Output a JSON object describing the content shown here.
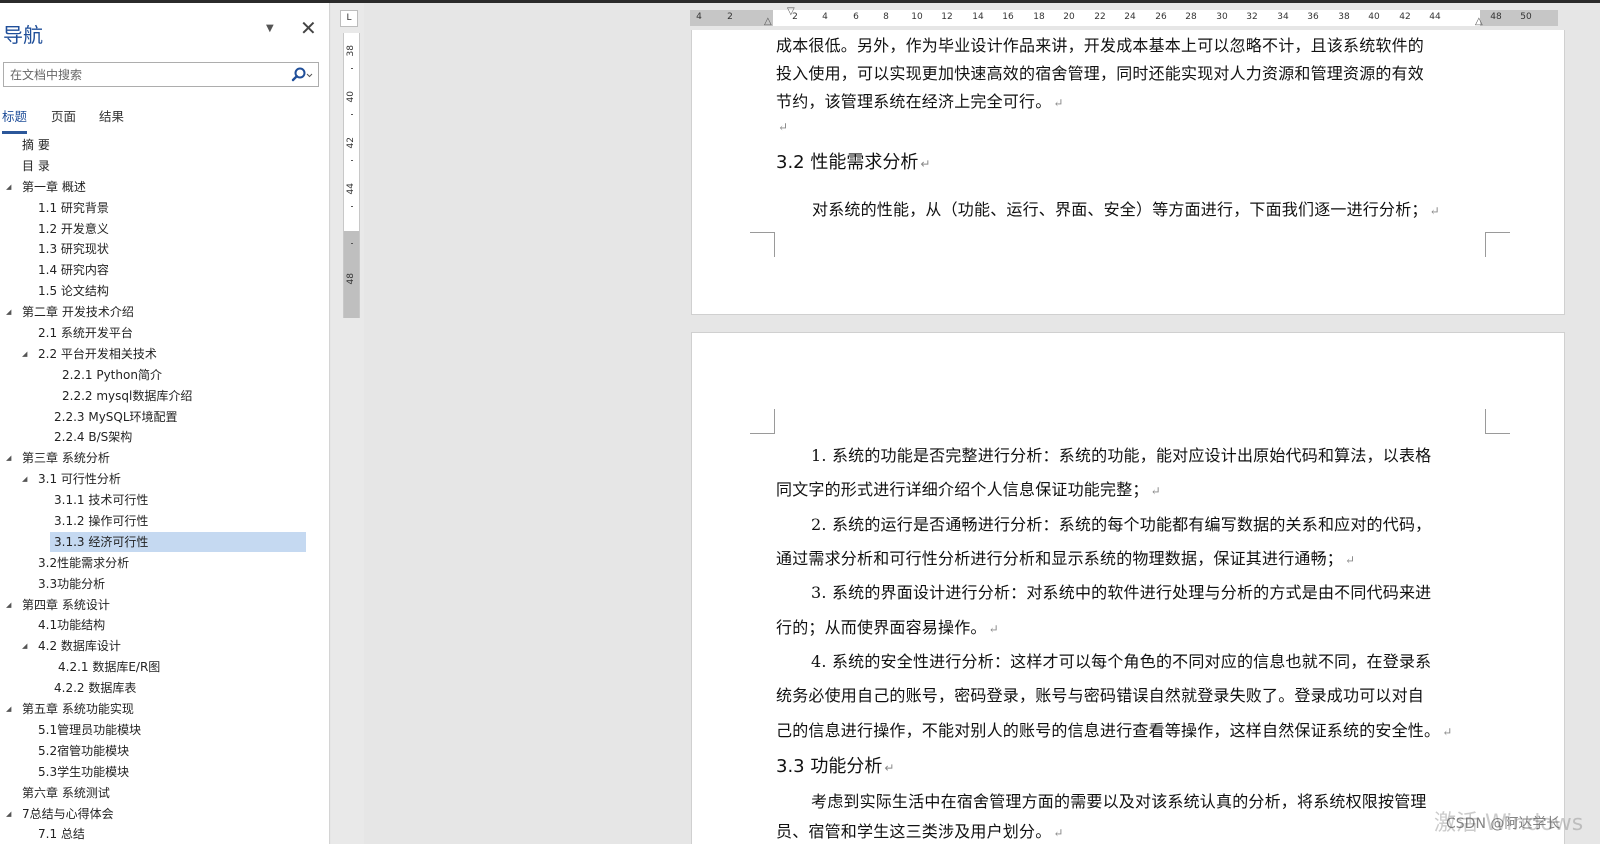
{
  "nav": {
    "title": "导航",
    "dropdown_icon": "triangle-down-icon",
    "close_glyph": "✕",
    "search": {
      "placeholder": "在文档中搜索"
    },
    "tabs": [
      {
        "label": "标题",
        "active": true
      },
      {
        "label": "页面",
        "active": false
      },
      {
        "label": "结果",
        "active": false
      }
    ],
    "headings": [
      {
        "label": "摘  要",
        "level": 0,
        "expand": false
      },
      {
        "label": "目  录",
        "level": 0,
        "expand": false
      },
      {
        "label": "第一章  概述",
        "level": 0,
        "expand": true
      },
      {
        "label": "1.1 研究背景",
        "level": 1,
        "expand": false
      },
      {
        "label": "1.2 开发意义",
        "level": 1,
        "expand": false
      },
      {
        "label": "1.3 研究现状",
        "level": 1,
        "expand": false
      },
      {
        "label": "1.4 研究内容",
        "level": 1,
        "expand": false
      },
      {
        "label": "1.5 论文结构",
        "level": 1,
        "expand": false
      },
      {
        "label": " 第二章  开发技术介绍",
        "level": 0,
        "expand": true
      },
      {
        "label": "2.1 系统开发平台",
        "level": 1,
        "expand": false
      },
      {
        "label": "2.2 平台开发相关技术",
        "level": 1,
        "expand": true
      },
      {
        "label": "2.2.1   Python简介",
        "level": 3,
        "expand": false
      },
      {
        "label": "2.2.2   mysql数据库介绍",
        "level": 3,
        "expand": false
      },
      {
        "label": "2.2.3   MySQL环境配置",
        "level": 2,
        "expand": false
      },
      {
        "label": "2.2.4   B/S架构",
        "level": 2,
        "expand": false
      },
      {
        "label": "第三章  系统分析",
        "level": 0,
        "expand": true
      },
      {
        "label": "3.1 可行性分析",
        "level": 1,
        "expand": true
      },
      {
        "label": "3.1.1 技术可行性",
        "level": 2,
        "expand": false
      },
      {
        "label": "3.1.2 操作可行性",
        "level": 2,
        "expand": false
      },
      {
        "label": "3.1.3 经济可行性",
        "level": 2,
        "expand": false,
        "selected": true
      },
      {
        "label": "3.2性能需求分析",
        "level": 1,
        "expand": false
      },
      {
        "label": "3.3功能分析",
        "level": 1,
        "expand": false
      },
      {
        "label": "第四章  系统设计",
        "level": 0,
        "expand": true
      },
      {
        "label": "4.1功能结构",
        "level": 1,
        "expand": false
      },
      {
        "label": "4.2 数据库设计",
        "level": 1,
        "expand": true
      },
      {
        "label": "4.2.1 数据库E/R图",
        "level": 2.3,
        "expand": false
      },
      {
        "label": "4.2.2 数据库表",
        "level": 2,
        "expand": false
      },
      {
        "label": "第五章  系统功能实现",
        "level": 0,
        "expand": true
      },
      {
        "label": "5.1管理员功能模块",
        "level": 1,
        "expand": false
      },
      {
        "label": "5.2宿管功能模块",
        "level": 1,
        "expand": false
      },
      {
        "label": "5.3学生功能模块",
        "level": 1,
        "expand": false
      },
      {
        "label": "第六章  系统测试",
        "level": 0,
        "expand": false
      },
      {
        "label": "7总结与心得体会",
        "level": 0,
        "expand": true
      },
      {
        "label": "7.1 总结",
        "level": 1,
        "expand": false
      }
    ]
  },
  "rulers": {
    "tab_selector": "L",
    "horizontal": [
      "4",
      "2",
      "2",
      "4",
      "6",
      "8",
      "10",
      "12",
      "14",
      "16",
      "18",
      "20",
      "22",
      "24",
      "26",
      "28",
      "30",
      "32",
      "34",
      "36",
      "38",
      "40",
      "42",
      "44",
      "48",
      "50"
    ],
    "vertical": [
      "38",
      "40",
      "42",
      "44",
      "48"
    ]
  },
  "document": {
    "page1": {
      "lines": [
        "成本很低。另外，作为毕业设计作品来讲，开发成本基本上可以忽略不计，且该系统软件的",
        "投入使用，可以实现更加快速高效的宿舍管理，同时还能实现对人力资源和管理资源的有效",
        "节约，该管理系统在经济上完全可行。",
        ""
      ],
      "heading": "3.2 性能需求分析",
      "para": "对系统的性能，从（功能、运行、界面、安全）等方面进行，下面我们逐一进行分析；"
    },
    "page2": {
      "lines": [
        "1.  系统的功能是否完整进行分析：系统的功能，能对应设计出原始代码和算法，以表格",
        "同文字的形式进行详细介绍个人信息保证功能完整；",
        "2.  系统的运行是否通畅进行分析：系统的每个功能都有编写数据的关系和应对的代码，",
        "通过需求分析和可行性分析进行分析和显示系统的物理数据，保证其进行通畅；",
        "3.  系统的界面设计进行分析：对系统中的软件进行处理与分析的方式是由不同代码来进",
        "行的；从而使界面容易操作。",
        "4.  系统的安全性进行分析：这样才可以每个角色的不同对应的信息也就不同，在登录系",
        "统务必使用自己的账号，密码登录，账号与密码错误自然就登录失败了。登录成功可以对自",
        "己的信息进行操作，不能对别人的账号的信息进行查看等操作，这样自然保证系统的安全性。"
      ],
      "heading": "3.3 功能分析",
      "tail": [
        "考虑到实际生活中在宿舍管理方面的需要以及对该系统认真的分析，将系统权限按管理",
        "员、宿管和学生这三类涉及用户划分。"
      ]
    },
    "paragraph_mark": "↵"
  },
  "overlay": {
    "watermark": "激活 Windows",
    "csdn": "CSDN @阿达学长"
  }
}
